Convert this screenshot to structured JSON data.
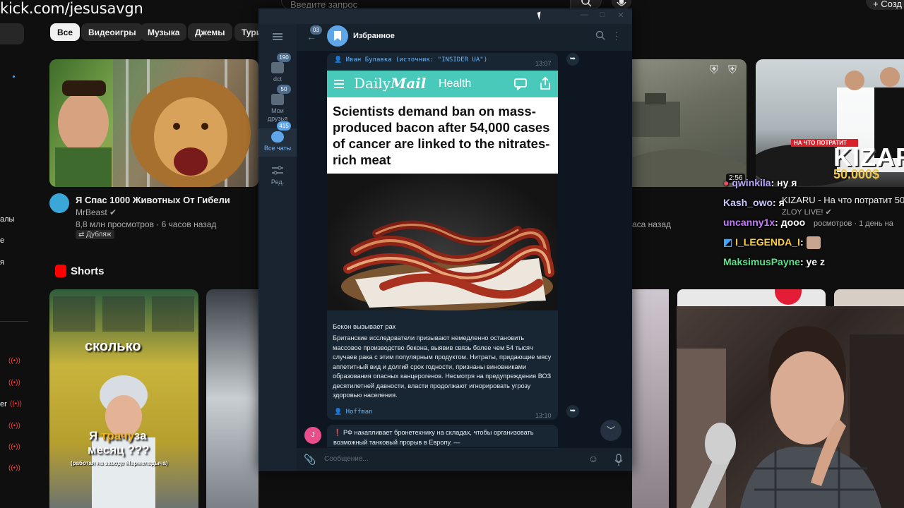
{
  "stream": {
    "url": "kick.com/jesusavgn"
  },
  "youtube": {
    "search_placeholder": "Введите запрос",
    "create_label": "Созд",
    "chips": [
      "Все",
      "Видеоигры",
      "Музыка",
      "Джемы",
      "Тури"
    ],
    "video1": {
      "title": "Я Спас 1000 Животных От Гибели",
      "channel": "MrBeast",
      "meta": "8,8 млн просмотров · 6 часов назад",
      "badge": "Дубляж"
    },
    "video2": {
      "meta_partial": "аса назад"
    },
    "video3": {
      "title_partial": "KIZARU - На что потратит 50 0",
      "channel": "ZLOY LIVE!",
      "meta": "росмотров · 1 день на",
      "duration": "2:56",
      "thumb_text_1": "НА ЧТО ПОТРАТИТ",
      "thumb_text_2": "KIZAR",
      "thumb_text_3": "50.000$"
    },
    "shorts_title": "Shorts",
    "short1_overlay": "сколько",
    "short1_caption_a": "Я ",
    "short1_caption_hl": "трачу",
    "short1_caption_b": "за",
    "short1_caption_c": "месяц ???",
    "short1_caption_sub": "(работая на заводе Мармеладыча)",
    "sidebar_fragments": [
      "алы",
      "е",
      "я",
      "er"
    ]
  },
  "chat_overlay": [
    {
      "user": "qwinkila",
      "color": "#b9a4ff",
      "text": ": ну я"
    },
    {
      "user": "Kash_owo",
      "color": "#c8c8ff",
      "text": ": я"
    },
    {
      "user": "uncanny1x",
      "color": "#c47bff",
      "text": ": дооо"
    },
    {
      "user": "I_LEGENDA_I",
      "color": "#ffcf3f",
      "text": ":"
    },
    {
      "user": "MaksimusPayne",
      "color": "#57e389",
      "text": ": ye z"
    }
  ],
  "telegram": {
    "chat_title": "Избранное",
    "back_badge": "03",
    "folders": [
      {
        "label": "dct",
        "badge": "190"
      },
      {
        "label": "Мои друзья",
        "badge": "50"
      },
      {
        "label": "Все чаты",
        "badge": "415"
      },
      {
        "label": "Ред.",
        "badge": ""
      }
    ],
    "message1": {
      "forwarded_from": "Иван Булавка (источник: \"INSIDER UA\")",
      "time": "13:07",
      "card_brand_a": "Daily",
      "card_brand_b": "Mail",
      "card_section": "Health",
      "card_headline": "Scientists demand ban on mass-produced bacon after 54,000 cases of cancer are linked to the nitrates-rich meat",
      "caption_title": "Бекон вызывает рак",
      "caption_body": "Британские исследователи призывают немедленно остановить массовое производство бекона, выявив связь более чем 54 тысяч случаев рака с этим популярным продуктом. Нитраты, придающие мясу аппетитный вид и долгий срок годности, признаны виновниками образования опасных канцерогенов. Несмотря на предупреждения ВОЗ десятилетней давности, власти продолжают игнорировать угрозу здоровью населения.",
      "author": "Hoffman",
      "author_time": "13:10"
    },
    "message2": {
      "avatar_letter": "J",
      "text": "❗ РФ накапливает бронетехнику на складах, чтобы организовать возможный танковый прорыв в Европу. —"
    },
    "input_placeholder": "Сообщение..."
  }
}
